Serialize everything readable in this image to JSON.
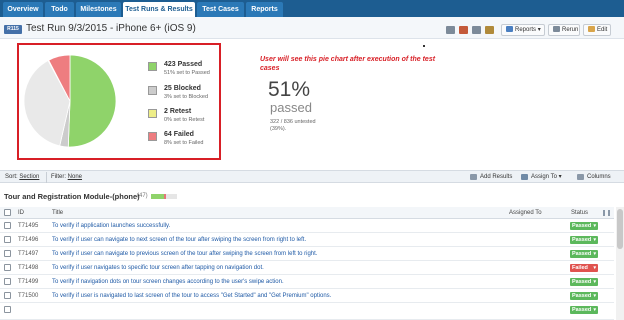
{
  "nav": {
    "tabs": [
      {
        "label": "Overview"
      },
      {
        "label": "Todo"
      },
      {
        "label": "Milestones"
      },
      {
        "label": "Test Runs & Results",
        "active": true
      },
      {
        "label": "Test Cases"
      },
      {
        "label": "Reports"
      }
    ]
  },
  "run": {
    "badge": "R115",
    "title": "Test Run 9/3/2015 - iPhone 6+ (iOS 9)",
    "icons": [
      "mail-icon",
      "export-icon",
      "print-icon",
      "lock-icon"
    ],
    "reports_label": "Reports",
    "rerun_label": "Rerun",
    "edit_label": "Edit"
  },
  "chart_data": {
    "type": "pie",
    "slices": [
      {
        "label": "Passed",
        "value": 423,
        "color": "#8fd36a"
      },
      {
        "label": "Blocked",
        "value": 25,
        "color": "#cccccc"
      },
      {
        "label": "Untested",
        "value": 322,
        "color": "#e9e9e9"
      },
      {
        "label": "Retest",
        "value": 2,
        "color": "#eeee88"
      },
      {
        "label": "Failed",
        "value": 64,
        "color": "#ee7d80"
      }
    ]
  },
  "legend": [
    {
      "label": "423 Passed",
      "sub": "51% set to Passed",
      "color": "#8fd36a"
    },
    {
      "label": "25 Blocked",
      "sub": "3% set to Blocked",
      "color": "#cccccc"
    },
    {
      "label": "2 Retest",
      "sub": "0% set to Retest",
      "color": "#eeee88"
    },
    {
      "label": "64 Failed",
      "sub": "8% set to Failed",
      "color": "#ee7d80"
    }
  ],
  "annotation": "User will see this pie chart after execution of the test cases",
  "summary": {
    "percent": "51%",
    "word": "passed",
    "untested": "322 / 836 untested (39%)."
  },
  "filterbar": {
    "sort_label": "Sort:",
    "sort_value": "Section",
    "filter_label": "Filter:",
    "filter_value": "None",
    "add_results": "Add Results",
    "assign_to": "Assign To",
    "columns": "Columns"
  },
  "section": {
    "title": "Tour and Registration Module-(phone)",
    "count": "(47)"
  },
  "table": {
    "headers": {
      "id": "ID",
      "title": "Title",
      "assigned": "Assigned To",
      "status": "Status"
    },
    "rows": [
      {
        "id": "T71495",
        "title": "To verify if application launches successfully.",
        "status": "Passed"
      },
      {
        "id": "T71496",
        "title": "To verify if user can navigate to next screen of the tour after swiping the screen from right to left.",
        "status": "Passed"
      },
      {
        "id": "T71497",
        "title": "To verify if user can navigate to previous screen of the tour after swiping the screen from left to right.",
        "status": "Passed"
      },
      {
        "id": "T71498",
        "title": "To verify if user navigates to specific tour screen after tapping on navigation dot.",
        "status": "Failed"
      },
      {
        "id": "T71499",
        "title": "To verify if navigation dots on tour screen changes according to the user's swipe action.",
        "status": "Passed"
      },
      {
        "id": "T71500",
        "title": "To verify if user is navigated to last screen of the tour to access \"Get Started\" and \"Get Premium\" options.",
        "status": "Passed"
      },
      {
        "id": "",
        "title": "",
        "status": "Passed"
      }
    ]
  },
  "colors": {
    "nav_bg": "#1d5d91",
    "tab_bg": "#2b79b7",
    "passed": "#5cb85c",
    "failed": "#e0534f",
    "annotation_red": "#d81f26",
    "link": "#1f5aa6"
  }
}
